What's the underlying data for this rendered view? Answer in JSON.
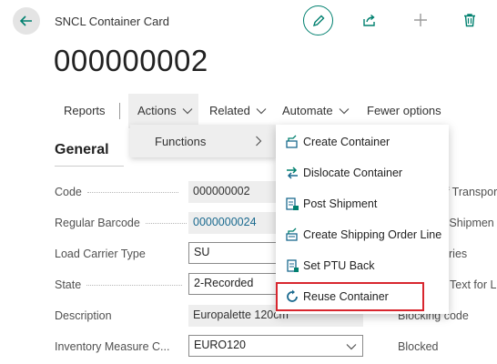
{
  "header": {
    "card_label": "SNCL Container Card",
    "title": "000000002"
  },
  "toolbar_icons": [
    "back-arrow-icon",
    "pencil-icon",
    "share-icon",
    "plus-icon",
    "trash-icon"
  ],
  "actionbar": {
    "reports": "Reports",
    "actions": "Actions",
    "related": "Related",
    "automate": "Automate",
    "fewer_options": "Fewer options"
  },
  "section": {
    "title": "General"
  },
  "fields": [
    {
      "label": "Code",
      "value": "000000002"
    },
    {
      "label": "Regular Barcode",
      "value": "0000000024"
    },
    {
      "label": "Load Carrier Type",
      "value": "SU"
    },
    {
      "label": "State",
      "value": "2-Recorded"
    },
    {
      "label": "Description",
      "value": "Europalette 120cm"
    },
    {
      "label": "Inventory Measure C...",
      "value": "EURO120"
    }
  ],
  "right_fields": [
    "of Transpor",
    "e Shipmen",
    "ries",
    "Text for L",
    "Blocking code",
    "Blocked"
  ],
  "functions_submenu": {
    "label": "Functions"
  },
  "menu": {
    "items": [
      {
        "label": "Create Container",
        "icon": "create-container-icon"
      },
      {
        "label": "Dislocate Container",
        "icon": "dislocate-icon"
      },
      {
        "label": "Post Shipment",
        "icon": "post-shipment-icon"
      },
      {
        "label": "Create Shipping Order Line",
        "icon": "shipping-order-icon"
      },
      {
        "label": "Set PTU Back",
        "icon": "set-back-icon"
      },
      {
        "label": "Reuse Container",
        "icon": "reuse-icon"
      }
    ]
  },
  "colors": {
    "accent": "#00806f",
    "link": "#1b6a8f",
    "highlight": "#d8262e"
  }
}
